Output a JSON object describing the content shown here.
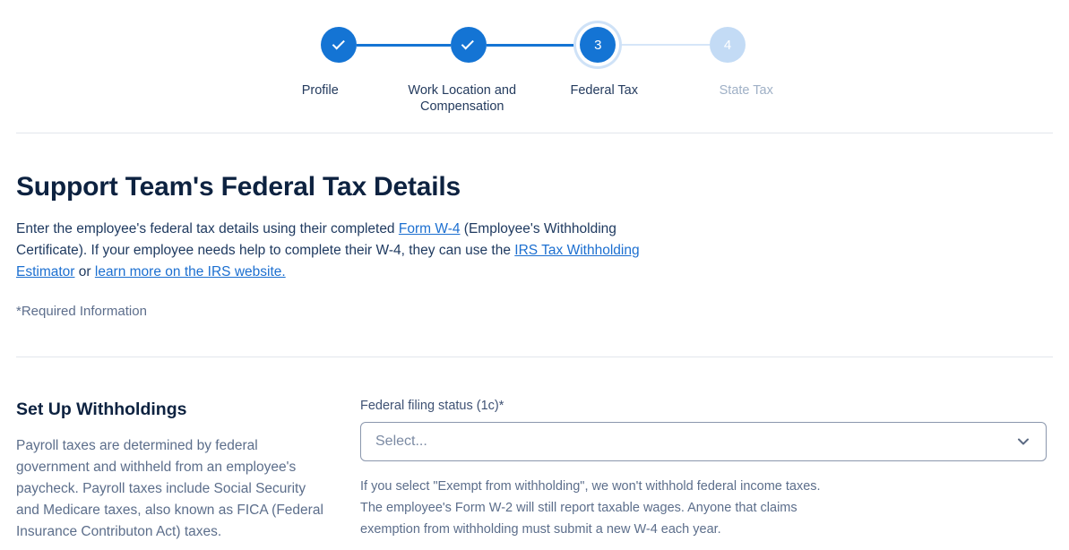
{
  "stepper": {
    "steps": [
      {
        "label": "Profile",
        "state": "done",
        "marker": "check-icon"
      },
      {
        "label": "Work Location and Compensation",
        "state": "done",
        "marker": "check-icon"
      },
      {
        "label": "Federal Tax",
        "state": "current",
        "marker": "3"
      },
      {
        "label": "State Tax",
        "state": "upcoming",
        "marker": "4"
      }
    ]
  },
  "intro": {
    "title": "Support Team's Federal Tax Details",
    "paragraph": {
      "p1": "Enter the employee's federal tax details using their completed ",
      "link1": "Form W-4",
      "p2": " (Employee's Withholding Certificate). If your employee needs help to complete their W-4, they can use the ",
      "link2": "IRS Tax Withholding Estimator",
      "p3": " or ",
      "link3": "learn more on the IRS website.",
      "p4": ""
    },
    "required_note": "*Required Information"
  },
  "withholdings": {
    "heading": "Set Up Withholdings",
    "body": "Payroll taxes are determined by federal government and withheld from an employee's paycheck. Payroll taxes include Social Security and Medicare taxes, also known as FICA (Federal Insurance Contributon Act) taxes."
  },
  "form": {
    "filing_status_label": "Federal filing status (1c)*",
    "filing_status_value": "Select...",
    "filing_status_placeholder": "Select...",
    "chevron_icon": "chevron-down-icon",
    "helper_line_1": "If you select \"Exempt from withholding\", we won't withhold federal income taxes.",
    "helper_line_2": "The employee's Form W-2 will still report taxable wages. Anyone that claims",
    "helper_line_3": "exemption from withholding must submit a new W-4 each year."
  },
  "colors": {
    "accent": "#1474d4",
    "accent_light": "#c3dbf5",
    "link": "#1c6fd0",
    "heading": "#0d2240",
    "body": "#1f3a60",
    "muted": "#5c6e8b",
    "border": "#8b97ad",
    "divider": "#e2e6ec"
  }
}
